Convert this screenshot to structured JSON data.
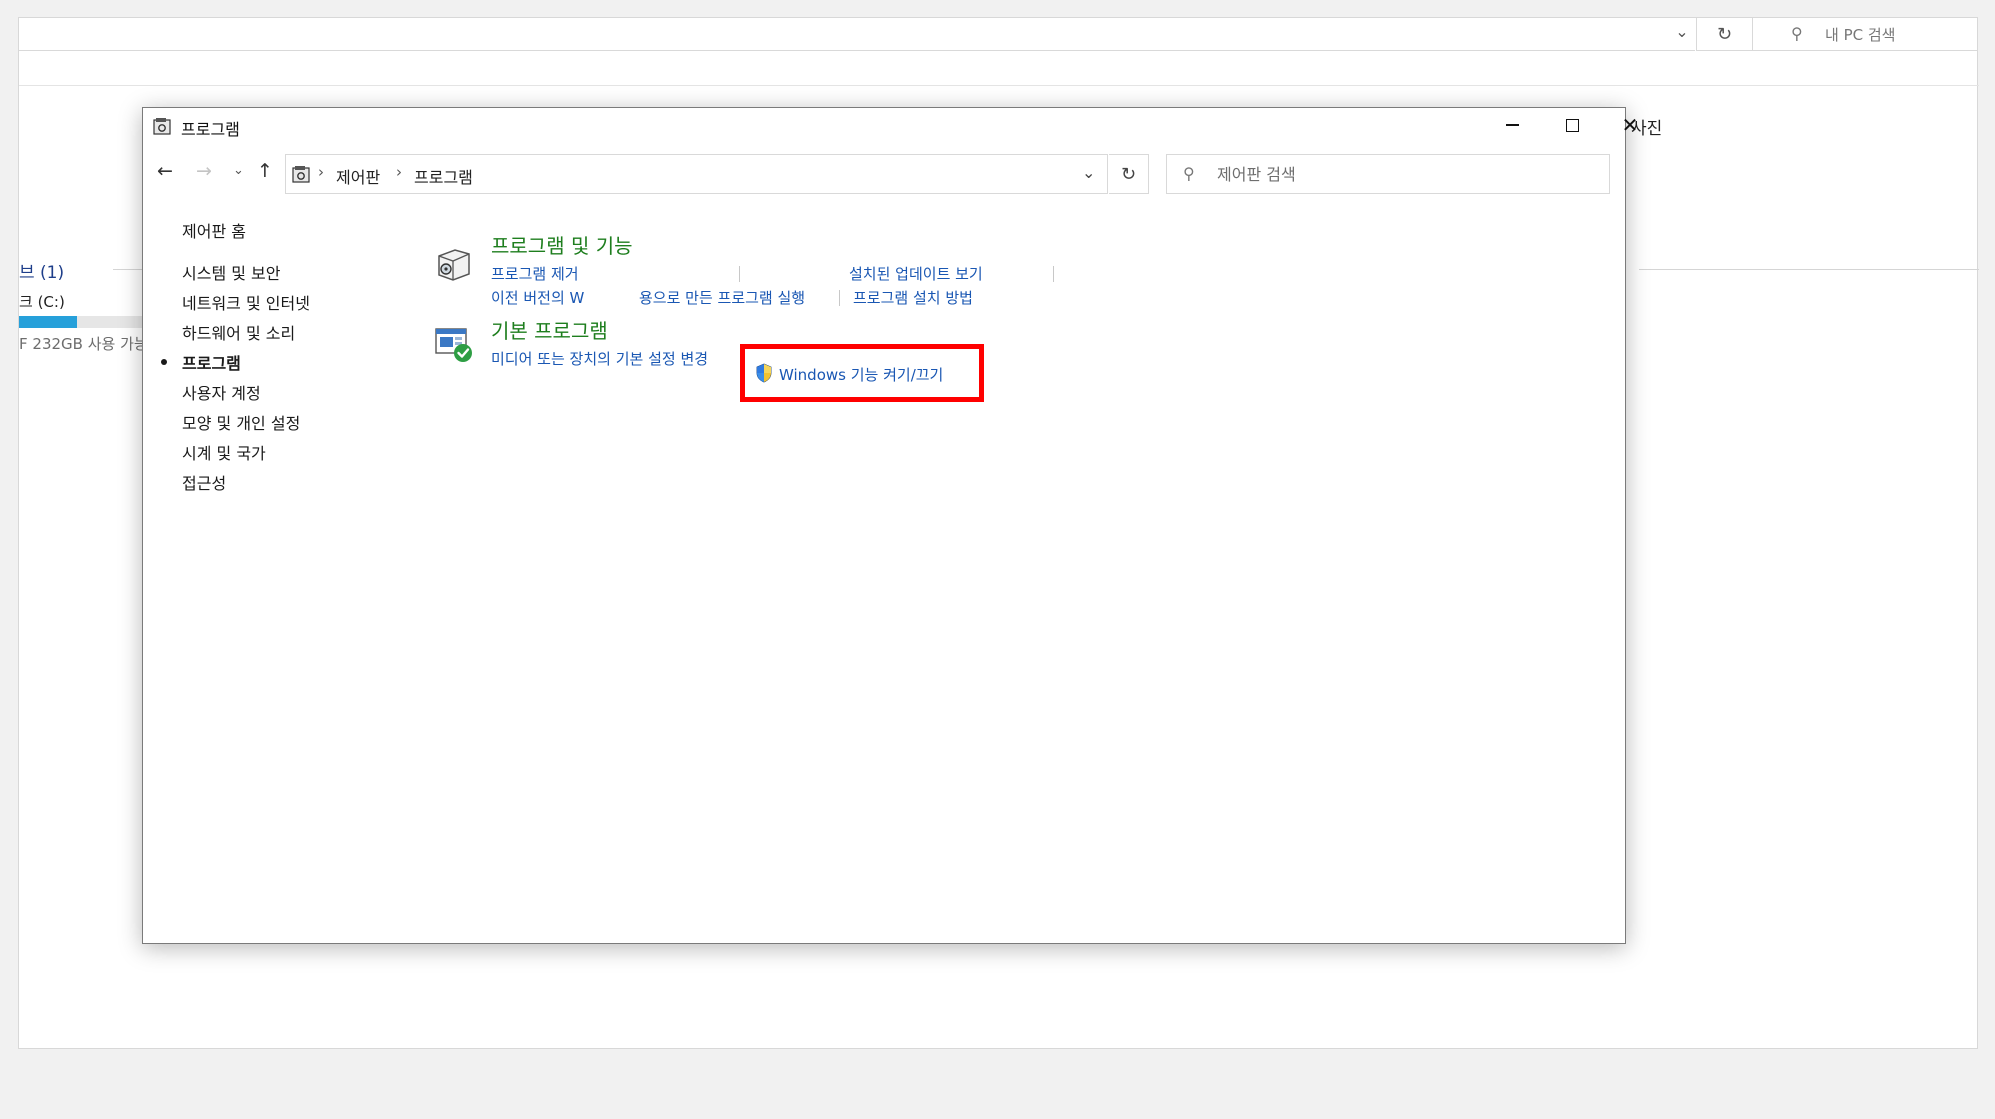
{
  "background_explorer": {
    "search_placeholder": "내 PC 검색",
    "folder_photos": "사진",
    "devices_heading": "브 (1)",
    "drive_label": "크 (C:)",
    "drive_free": "F 232GB 사용 가능",
    "drive_usage_fraction": 0.46
  },
  "window": {
    "title": "프로그램"
  },
  "address": {
    "crumb_1": "제어판",
    "crumb_2": "프로그램",
    "separator": "›"
  },
  "search": {
    "placeholder": "제어판 검색"
  },
  "left_nav": {
    "home": "제어판 홈",
    "items": [
      "시스템 및 보안",
      "네트워크 및 인터넷",
      "하드웨어 및 소리",
      "프로그램",
      "사용자 계정",
      "모양 및 개인 설정",
      "시계 및 국가",
      "접근성"
    ],
    "active_index": 3
  },
  "categories": {
    "programs_features": {
      "title": "프로그램 및 기능",
      "links": {
        "uninstall": "프로그램 제거",
        "windows_features": "Windows 기능 켜기/끄기",
        "installed_updates": "설치된 업데이트 보기",
        "run_older": "이전 버전의 W",
        "run_older_tail": "용으로 만든 프로그램 실행",
        "how_to_install": "프로그램 설치 방법"
      }
    },
    "default_programs": {
      "title": "기본 프로그램",
      "links": {
        "media_defaults": "미디어 또는 장치의 기본 설정 변경"
      }
    }
  },
  "colors": {
    "link": "#1a57b3",
    "category_title": "#1e7e1e",
    "highlight": "#ff0000"
  }
}
